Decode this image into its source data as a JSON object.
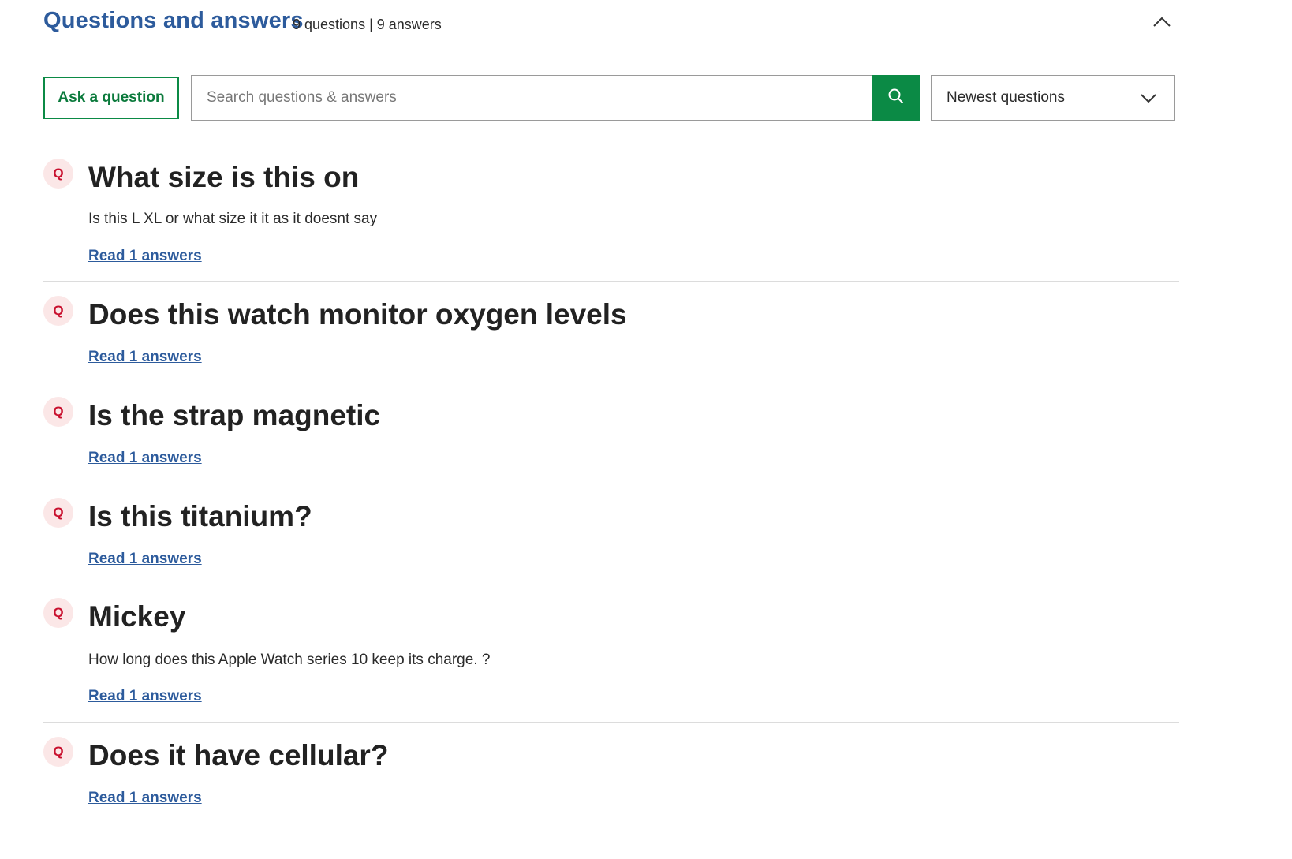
{
  "header": {
    "title": "Questions and answers",
    "counts": "9 questions | 9 answers",
    "collapse_icon": "chevron-up-icon"
  },
  "toolbar": {
    "ask_label": "Ask a question",
    "search_placeholder": "Search questions & answers",
    "search_value": "",
    "search_icon": "search-icon",
    "sort_selected": "Newest questions",
    "sort_icon": "chevron-down-icon"
  },
  "colors": {
    "title_blue": "#2d5b9c",
    "brand_green": "#0b8a45",
    "badge_red": "#c8102e",
    "badge_bg": "#fbe7e7"
  },
  "questions": [
    {
      "badge": "Q",
      "title": "What size is this on",
      "body": "Is this L XL or what size it it as it doesnt say",
      "link": "Read 1 answers"
    },
    {
      "badge": "Q",
      "title": "Does this watch monitor oxygen levels",
      "body": "",
      "link": "Read 1 answers"
    },
    {
      "badge": "Q",
      "title": "Is the strap magnetic",
      "body": "",
      "link": "Read 1 answers"
    },
    {
      "badge": "Q",
      "title": "Is this titanium?",
      "body": "",
      "link": "Read 1 answers"
    },
    {
      "badge": "Q",
      "title": "Mickey",
      "body": "How long does this Apple Watch series 10 keep its charge. ?",
      "link": "Read 1 answers"
    },
    {
      "badge": "Q",
      "title": "Does it have cellular?",
      "body": "",
      "link": "Read 1 answers"
    }
  ]
}
